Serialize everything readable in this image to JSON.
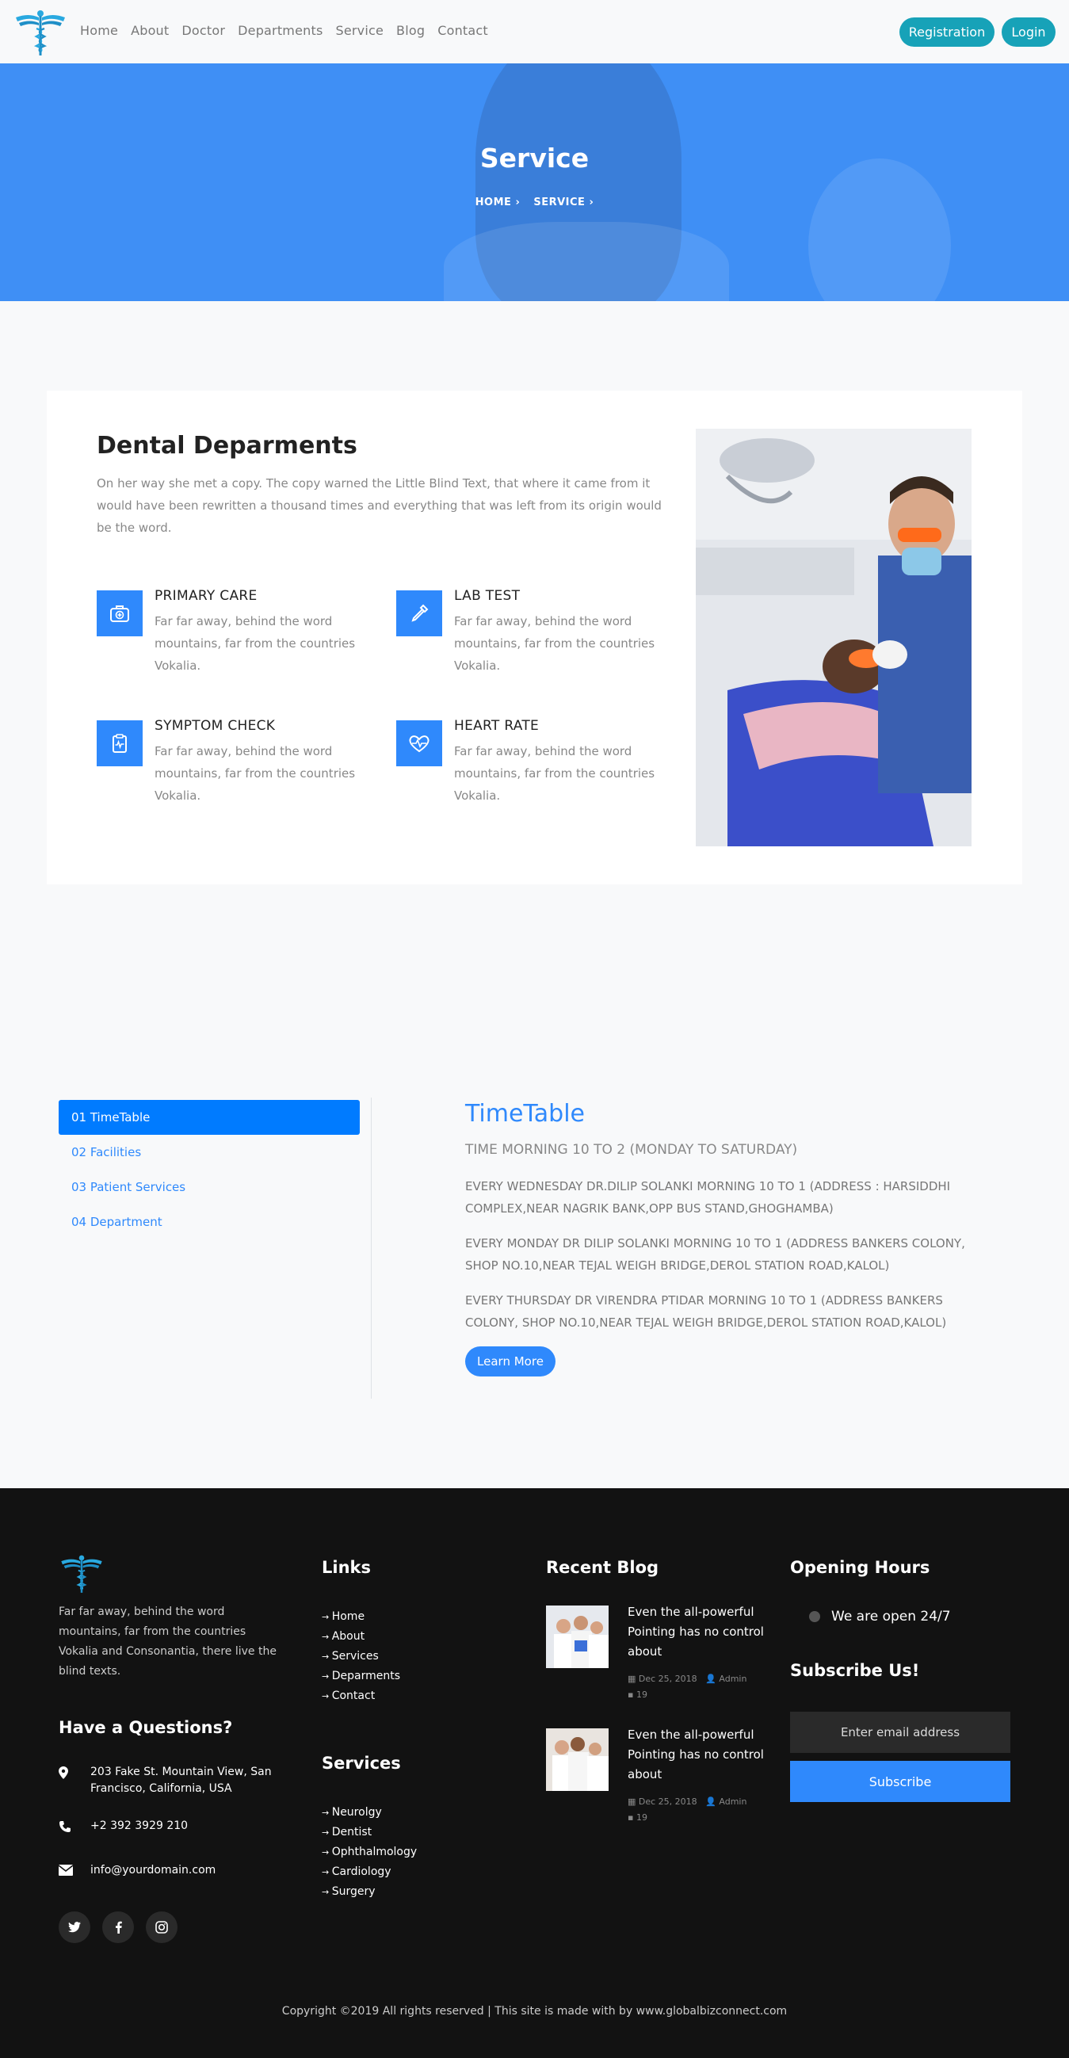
{
  "nav": {
    "items": [
      "Home",
      "About",
      "Doctor",
      "Departments",
      "Service",
      "Blog",
      "Contact"
    ],
    "registration": "Registration",
    "login": "Login"
  },
  "hero": {
    "title": "Service",
    "crumbs": [
      "HOME",
      "SERVICE"
    ]
  },
  "dental": {
    "title": "Dental Deparments",
    "lead": "On her way she met a copy. The copy warned the Little Blind Text, that where it came from it would have been rewritten a thousand times and everything that was left from its origin would be the word.",
    "features": [
      {
        "title": "PRIMARY CARE",
        "text": "Far far away, behind the word mountains, far from the countries Vokalia.",
        "icon": "medical-kit-icon"
      },
      {
        "title": "LAB TEST",
        "text": "Far far away, behind the word mountains, far from the countries Vokalia.",
        "icon": "dropper-icon"
      },
      {
        "title": "SYMPTOM CHECK",
        "text": "Far far away, behind the word mountains, far from the countries Vokalia.",
        "icon": "clipboard-icon"
      },
      {
        "title": "HEART RATE",
        "text": "Far far away, behind the word mountains, far from the countries Vokalia.",
        "icon": "heart-rate-icon"
      }
    ]
  },
  "tabs": [
    "01 TimeTable",
    "02 Facilities",
    "03 Patient Services",
    "04 Department"
  ],
  "timetable": {
    "title": "TimeTable",
    "subtitle": "TIME MORNING 10 TO 2 (MONDAY TO SATURDAY)",
    "entries": [
      "EVERY WEDNESDAY DR.DILIP SOLANKI MORNING 10 TO 1 (ADDRESS : HARSIDDHI COMPLEX,NEAR NAGRIK BANK,OPP BUS STAND,GHOGHAMBA)",
      "EVERY MONDAY DR DILIP SOLANKI MORNING 10 TO 1 (ADDRESS BANKERS COLONY, SHOP NO.10,NEAR TEJAL WEIGH BRIDGE,DEROL STATION ROAD,KALOL)",
      "EVERY THURSDAY DR VIRENDRA PTIDAR MORNING 10 TO 1 (ADDRESS BANKERS COLONY, SHOP NO.10,NEAR TEJAL WEIGH BRIDGE,DEROL STATION ROAD,KALOL)"
    ],
    "button": "Learn More"
  },
  "footer": {
    "about": "Far far away, behind the word mountains, far from the countries Vokalia and Consonantia, there live the blind texts.",
    "questions_title": "Have a Questions?",
    "address": "203 Fake St. Mountain View, San Francisco, California, USA",
    "phone": "+2 392 3929 210",
    "email": "info@yourdomain.com",
    "links_title": "Links",
    "links": [
      "Home",
      "About",
      "Services",
      "Deparments",
      "Contact"
    ],
    "services_title": "Services",
    "services": [
      "Neurolgy",
      "Dentist",
      "Ophthalmology",
      "Cardiology",
      "Surgery"
    ],
    "blog_title": "Recent Blog",
    "blog": [
      {
        "title": "Even the all-powerful Pointing has no control about",
        "date": "Dec 25, 2018",
        "author": "Admin",
        "comments": "19"
      },
      {
        "title": "Even the all-powerful Pointing has no control about",
        "date": "Dec 25, 2018",
        "author": "Admin",
        "comments": "19"
      }
    ],
    "hours_title": "Opening Hours",
    "hours_text": "We are open 24/7",
    "subscribe_title": "Subscribe Us!",
    "email_placeholder": "Enter email address",
    "subscribe_button": "Subscribe",
    "copyright": "Copyright ©2019 All rights reserved | This site is made with by www.globalbizconnect.com"
  },
  "colors": {
    "primary": "#2f89fc",
    "accent": "#17a2b8",
    "footer": "#121212"
  }
}
